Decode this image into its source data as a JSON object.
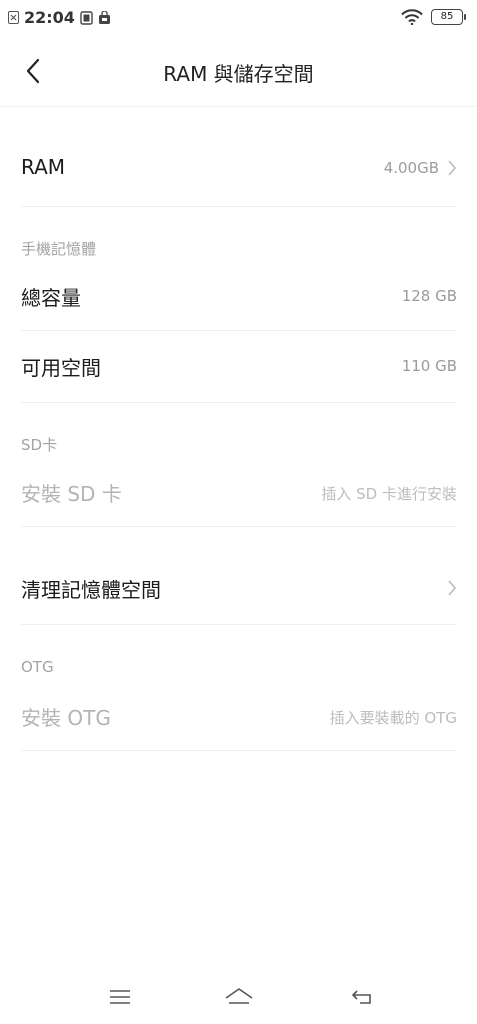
{
  "status_bar": {
    "time": "22:04",
    "battery": "85"
  },
  "header": {
    "title": "RAM 與儲存空間"
  },
  "ram": {
    "label": "RAM",
    "value": "4.00GB"
  },
  "phone_memory": {
    "section": "手機記憶體",
    "total_label": "總容量",
    "total_value": "128 GB",
    "available_label": "可用空間",
    "available_value": "110 GB"
  },
  "sd_card": {
    "section": "SD卡",
    "install_label": "安裝 SD 卡",
    "install_hint": "插入 SD 卡進行安裝"
  },
  "clean": {
    "label": "清理記憶體空間"
  },
  "otg": {
    "section": "OTG",
    "install_label": "安裝 OTG",
    "install_hint": "插入要裝載的 OTG"
  },
  "nav": {
    "icons": [
      "menu-icon",
      "home-icon",
      "back-icon"
    ]
  }
}
